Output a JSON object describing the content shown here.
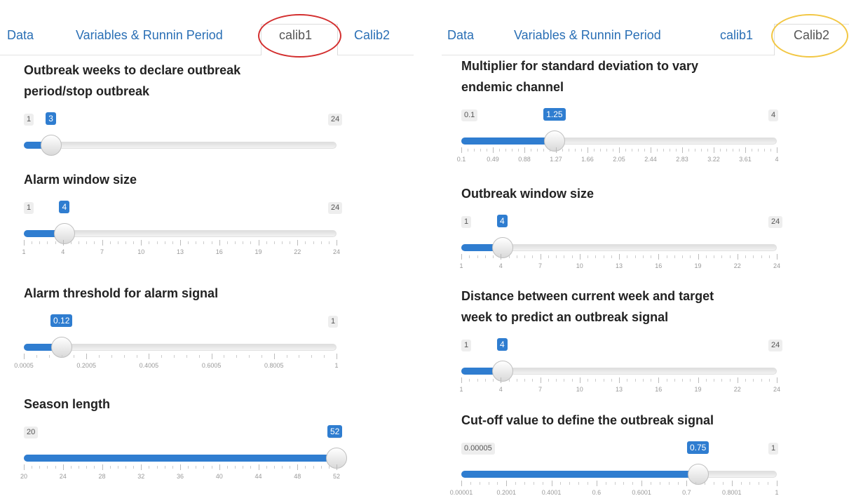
{
  "colors": {
    "accent": "#2f7dd0",
    "link": "#2a6fb5",
    "calib1_circle": "#d32f2f",
    "calib2_circle": "#f2c744"
  },
  "left": {
    "tabs": [
      {
        "label": "Data",
        "active": false
      },
      {
        "label": "Variables & Runnin Period",
        "active": false
      },
      {
        "label": "calib1",
        "active": true
      },
      {
        "label": "Calib2",
        "active": false
      }
    ],
    "sliders": [
      {
        "label_lines": [
          "Outbreak weeks to declare outbreak",
          "period/stop outbreak"
        ],
        "min": "1",
        "max": "24",
        "value": "3",
        "fraction": 0.087,
        "ticks": []
      },
      {
        "label_lines": [
          "Alarm window size"
        ],
        "min": "1",
        "max": "24",
        "value": "4",
        "fraction": 0.13,
        "ticks": [
          "1",
          "4",
          "7",
          "10",
          "13",
          "16",
          "19",
          "22",
          "24"
        ]
      },
      {
        "label_lines": [
          "Alarm threshold for alarm signal"
        ],
        "min": "",
        "max": "1",
        "value": "0.12",
        "fraction": 0.12,
        "ticks": [
          "0.0005",
          "0.2005",
          "0.4005",
          "0.6005",
          "0.8005",
          "1"
        ]
      },
      {
        "label_lines": [
          "Season length"
        ],
        "min": "20",
        "max": "52",
        "value": "52",
        "fraction": 1.0,
        "ticks": [
          "20",
          "24",
          "28",
          "32",
          "36",
          "40",
          "44",
          "48",
          "52"
        ]
      }
    ]
  },
  "right": {
    "tabs": [
      {
        "label": "Data",
        "active": false
      },
      {
        "label": "Variables & Runnin Period",
        "active": false
      },
      {
        "label": "calib1",
        "active": false
      },
      {
        "label": "Calib2",
        "active": true
      }
    ],
    "sliders": [
      {
        "label_lines": [
          "Multiplier for standard deviation to vary",
          "endemic channel"
        ],
        "min": "0.1",
        "max": "4",
        "value": "1.25",
        "fraction": 0.295,
        "ticks": [
          "0.1",
          "0.49",
          "0.88",
          "1.27",
          "1.66",
          "2.05",
          "2.44",
          "2.83",
          "3.22",
          "3.61",
          "4"
        ]
      },
      {
        "label_lines": [
          "Outbreak window size"
        ],
        "min": "1",
        "max": "24",
        "value": "4",
        "fraction": 0.13,
        "ticks": [
          "1",
          "4",
          "7",
          "10",
          "13",
          "16",
          "19",
          "22",
          "24"
        ]
      },
      {
        "label_lines": [
          "Distance between current week and target",
          "week to predict an outbreak signal"
        ],
        "min": "1",
        "max": "24",
        "value": "4",
        "fraction": 0.13,
        "ticks": [
          "1",
          "4",
          "7",
          "10",
          "13",
          "16",
          "19",
          "22",
          "24"
        ]
      },
      {
        "label_lines": [
          "Cut-off value to define the outbreak signal"
        ],
        "min": "0.00005",
        "max": "1",
        "value": "0.75",
        "fraction": 0.75,
        "ticks": [
          "0.00001",
          "0.2001",
          "0.4001",
          "0.6",
          "0.6001",
          "0.7",
          "0.8001",
          "1"
        ]
      }
    ]
  }
}
